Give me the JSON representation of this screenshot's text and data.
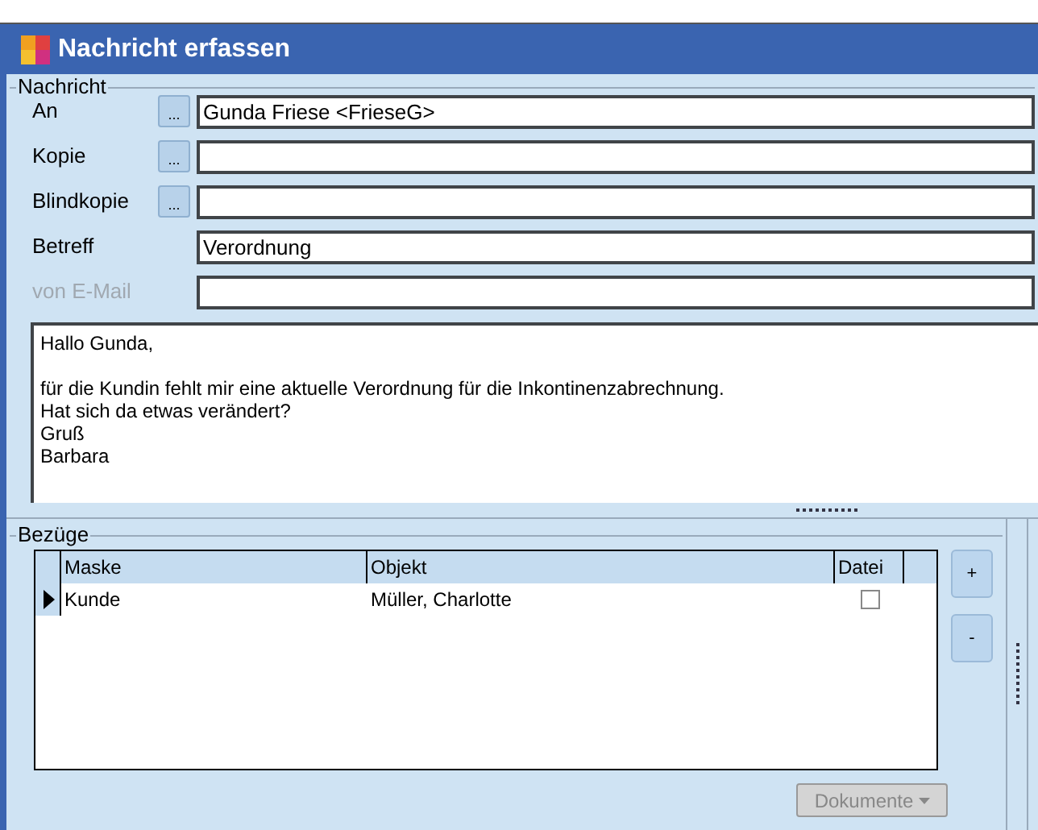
{
  "window": {
    "title": "Nachricht erfassen"
  },
  "message": {
    "legend": "Nachricht",
    "fields": [
      {
        "label": "An",
        "value": "Gunda Friese <FrieseG>",
        "has_picker": true,
        "picker_label": "...",
        "disabled": false
      },
      {
        "label": "Kopie",
        "has_picker": true,
        "picker_label": "...",
        "disabled": false
      },
      {
        "label": "Blindkopie",
        "has_picker": true,
        "picker_label": "...",
        "disabled": false
      },
      {
        "label": "Betreff",
        "value": "Verordnung",
        "has_picker": false,
        "disabled": false
      },
      {
        "label": "von E-Mail",
        "has_picker": false,
        "disabled": true
      }
    ],
    "body": "Hallo Gunda,\n\nfür die Kundin fehlt mir eine aktuelle Verordnung für die Inkontinenzabrechnung.\nHat sich da etwas verändert?\nGruß\nBarbara"
  },
  "references": {
    "legend": "Bezüge",
    "columns": [
      "Maske",
      "Objekt",
      "Datei"
    ],
    "rows": [
      {
        "maske": "Kunde",
        "objekt": "Müller, Charlotte",
        "checked": false,
        "selected": true
      }
    ],
    "add_button": "+",
    "remove_button": "-",
    "documents_button": {
      "label": "Dokumente",
      "disabled": true
    }
  }
}
